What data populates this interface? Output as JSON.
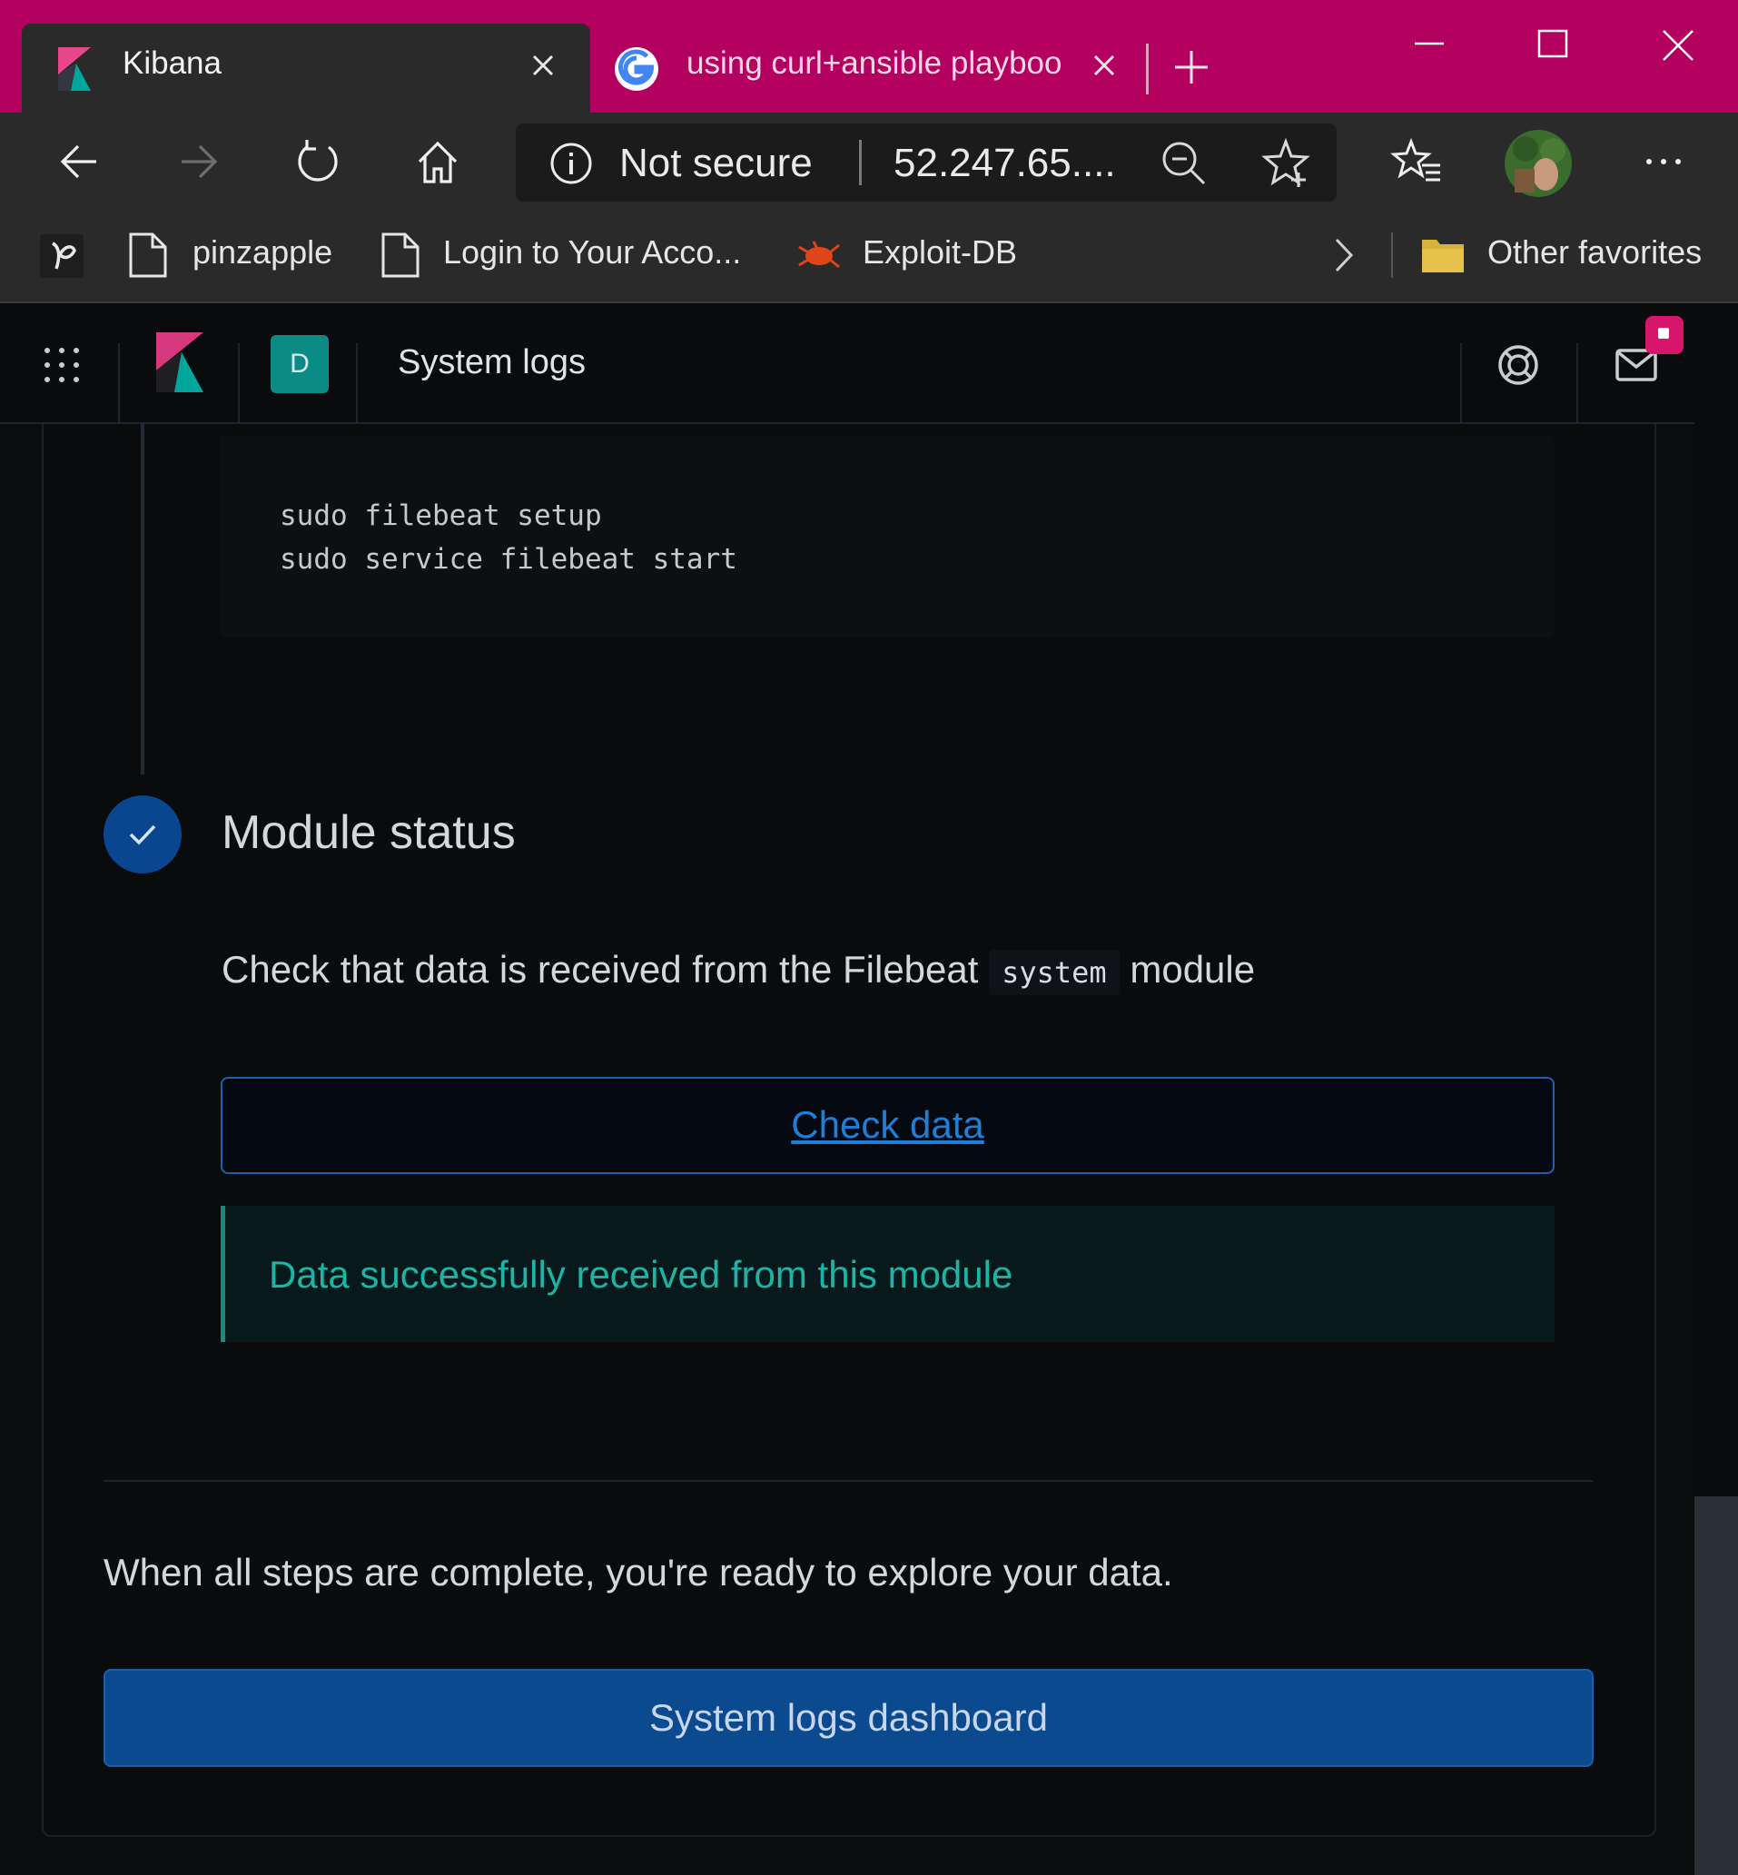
{
  "browser": {
    "tabs": [
      {
        "title": "Kibana",
        "active": true
      },
      {
        "title": "using curl+ansible playboo",
        "active": false
      }
    ],
    "address": {
      "security_label": "Not secure",
      "url": "52.247.65...."
    },
    "favorites": [
      {
        "label": "pinzapple"
      },
      {
        "label": "Login to Your Acco..."
      },
      {
        "label": "Exploit-DB"
      }
    ],
    "other_favorites": "Other favorites",
    "accent_color": "#b4005f"
  },
  "kibana": {
    "space_initial": "D",
    "page_title": "System logs",
    "code_lines": [
      "sudo filebeat setup",
      "sudo service filebeat start"
    ],
    "step": {
      "title": "Module status",
      "desc_before": "Check that data is received from the Filebeat ",
      "desc_code": "system",
      "desc_after": " module",
      "check_button": "Check data",
      "success_message": "Data successfully received from this module"
    },
    "ready_text": "When all steps are complete, you're ready to explore your data.",
    "dashboard_button": "System logs dashboard"
  }
}
